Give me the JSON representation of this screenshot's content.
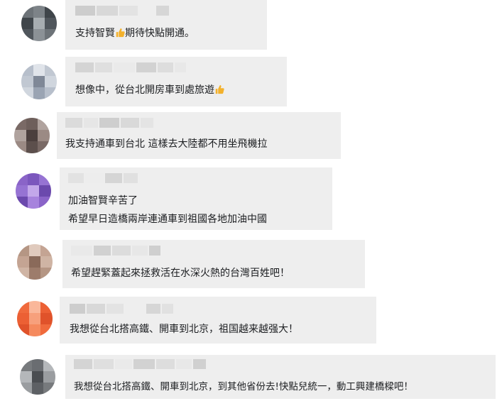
{
  "comments": [
    {
      "lines": [
        "支持智賢",
        "期待快點開通。"
      ],
      "thumb_after_first_segment": true,
      "avatar_colors": [
        "#6d7378",
        "#8b9196",
        "#50565c",
        "#a7adb1",
        "#3f454a",
        "#7d8388"
      ]
    },
    {
      "lines": [
        "想像中，從台北開房車到處旅遊"
      ],
      "thumb_at_end": true,
      "avatar_colors": [
        "#b7bfcb",
        "#9aa4b3",
        "#d0d6de",
        "#7f8897",
        "#c1c8d2",
        "#e0e4ea"
      ]
    },
    {
      "lines": [
        "我支持通車到台北 這樣去大陸都不用坐飛機拉"
      ],
      "avatar_colors": [
        "#7a6a66",
        "#5c4f4c",
        "#9b8a84",
        "#4b3f3d",
        "#b0a39e",
        "#6e5f5b"
      ]
    },
    {
      "lines": [
        "加油智賢辛苦了",
        "希望早日造橋兩岸連通車到祖國各地加油中國"
      ],
      "avatar_colors": [
        "#8a64c8",
        "#a783dd",
        "#6b49ad",
        "#c3a8ea",
        "#9673d3",
        "#7b57bd"
      ]
    },
    {
      "lines": [
        "希望趕緊蓋起來拯救活在水深火熱的台灣百姓吧！"
      ],
      "avatar_colors": [
        "#b59684",
        "#9d7c6b",
        "#cfb4a4",
        "#8a6a5a",
        "#c4a493",
        "#e0cabd"
      ]
    },
    {
      "lines": [
        "我想從台北搭高鐵、開車到北京，祖国越来越强大！"
      ],
      "avatar_colors": [
        "#f06a3c",
        "#f58a5e",
        "#e0522a",
        "#f7a07c",
        "#ec6034",
        "#fab79a"
      ]
    },
    {
      "lines": [
        "我想從台北搭高鐵、開車到北京，到其他省份去!快點兒統一，動工興建橋樑吧！"
      ],
      "avatar_colors": [
        "#777a7d",
        "#5d6064",
        "#9a9da0",
        "#4a4d51",
        "#b4b7ba",
        "#6a6d71"
      ]
    }
  ],
  "icons": {
    "thumb": "thumbs-up-icon"
  },
  "colors": {
    "bubble": "#eeeeee",
    "text": "#1c1e21",
    "thumb": "#f3b12c",
    "name_blur": "#d6d6d6"
  }
}
